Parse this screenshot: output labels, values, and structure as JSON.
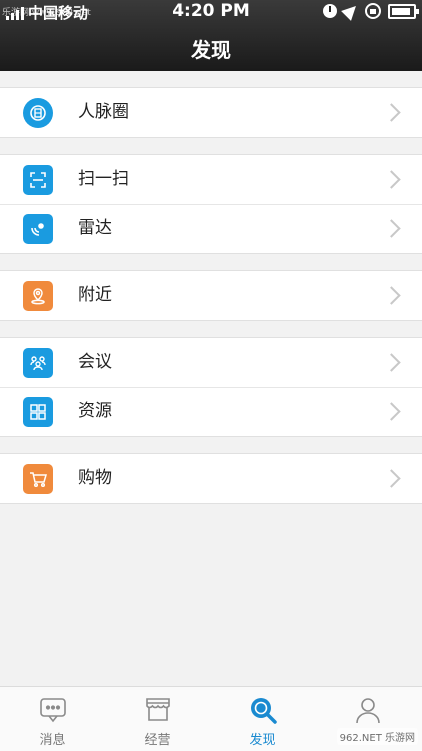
{
  "status_bar": {
    "carrier": "中国移动",
    "time": "4:20 PM"
  },
  "nav": {
    "title": "发现"
  },
  "groups": [
    {
      "items": [
        {
          "label": "人脉圈",
          "icon": "circle-people-icon",
          "color": "#1a9be0"
        }
      ]
    },
    {
      "items": [
        {
          "label": "扫一扫",
          "icon": "scan-icon",
          "color": "#1a9be0"
        },
        {
          "label": "雷达",
          "icon": "radar-icon",
          "color": "#1a9be0"
        }
      ]
    },
    {
      "items": [
        {
          "label": "附近",
          "icon": "nearby-location-icon",
          "color": "#f08a3c"
        }
      ]
    },
    {
      "items": [
        {
          "label": "会议",
          "icon": "meeting-icon",
          "color": "#1a9be0"
        },
        {
          "label": "资源",
          "icon": "resources-icon",
          "color": "#1a9be0"
        }
      ]
    },
    {
      "items": [
        {
          "label": "购物",
          "icon": "shopping-cart-icon",
          "color": "#f08a3c"
        }
      ]
    }
  ],
  "tabs": [
    {
      "label": "消息",
      "icon": "message-bubble-icon",
      "active": false
    },
    {
      "label": "经营",
      "icon": "store-icon",
      "active": false
    },
    {
      "label": "发现",
      "icon": "discover-search-icon",
      "active": true
    },
    {
      "label": "",
      "icon": "profile-person-icon",
      "active": false
    }
  ],
  "watermarks": {
    "top_left": "乐游网 www.962.net",
    "bottom_right": "962.NET 乐游网"
  },
  "colors": {
    "accent": "#1a8ad0",
    "blue_icon": "#1a9be0",
    "orange_icon": "#f08a3c"
  }
}
